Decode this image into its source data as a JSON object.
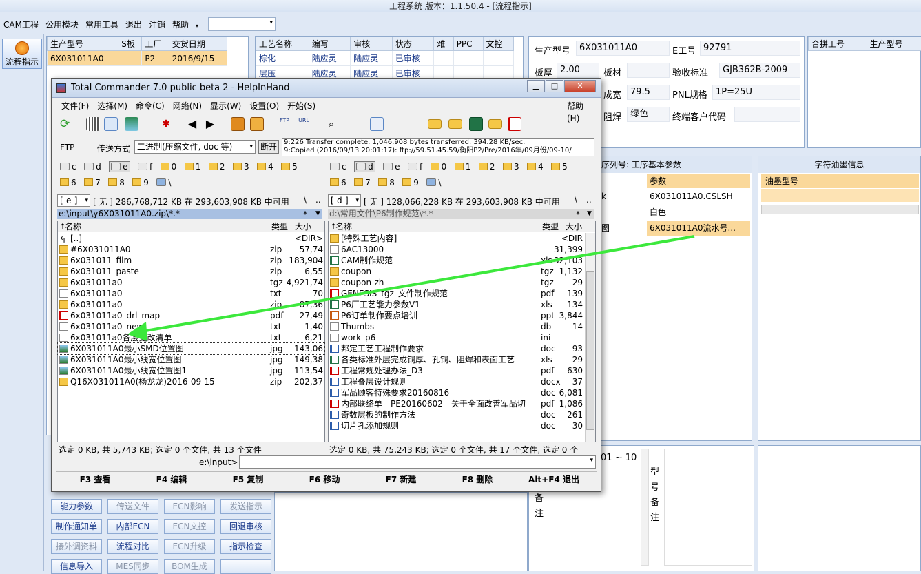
{
  "app": {
    "title": "工程系统   版本：1.1.50.4 - [流程指示]"
  },
  "menu": [
    "CAM工程",
    "公用模块",
    "常用工具",
    "退出",
    "注销",
    "帮助"
  ],
  "flow_button": "流程指示",
  "orders": {
    "headers": [
      "生产型号",
      "S板",
      "工厂",
      "交货日期"
    ],
    "rows": [
      [
        "6X031011A0",
        "",
        "P2",
        "2016/9/15"
      ]
    ]
  },
  "process": {
    "headers": [
      "工艺名称",
      "编写",
      "审核",
      "状态",
      "难",
      "PPC",
      "文控"
    ],
    "rows": [
      [
        "棕化",
        "陆应灵",
        "陆应灵",
        "已审核"
      ],
      [
        "层压",
        "陆应灵",
        "陆应灵",
        "已审核"
      ]
    ]
  },
  "info": {
    "model_label": "生产型号",
    "model": "6X031011A0",
    "e_label": "E工号",
    "e_value": "92791",
    "thick_label": "板厚",
    "thick": "2.00",
    "material_label": "板材",
    "material": "",
    "std_label": "验收标准",
    "std": "GJB362B-2009",
    "width_label": "成宽",
    "width": "79.5",
    "pnl_label": "PNL规格",
    "pnl": "1P=25U",
    "mask_label": "阻焊",
    "mask": "绿色",
    "customer_label": "终端客户代码",
    "customer": ""
  },
  "merge": {
    "headers": [
      "合拼工号",
      "生产型号"
    ]
  },
  "params": {
    "title": "序列号: 工序基本参数",
    "col": "参数",
    "rows": [
      [
        "k",
        "6X031011A0.CSLSH"
      ],
      [
        "",
        "白色"
      ],
      [
        "图",
        "6X031011A0流水号..."
      ]
    ]
  },
  "ink": {
    "title": "字符油墨信息",
    "col": "油墨型号"
  },
  "remark": {
    "range": "01 ~ 10",
    "model_v": "型号备注",
    "remark_v": "备注"
  },
  "buttons": [
    [
      "能力参数",
      "传送文件",
      "ECN影响",
      "发送指示"
    ],
    [
      "制作通知单",
      "内部ECN",
      "ECN文控",
      "回退审核"
    ],
    [
      "接外调资料",
      "流程对比",
      "ECN升级",
      "指示检查"
    ],
    [
      "信息导入",
      "MES同步",
      "BOM生成",
      ""
    ]
  ],
  "tc": {
    "title": "Total Commander 7.0 public beta 2 - HelpInHand",
    "menu": [
      "文件(F)",
      "选择(M)",
      "命令(C)",
      "网络(N)",
      "显示(W)",
      "设置(O)",
      "开始(S)"
    ],
    "help": "帮助(H)",
    "ftp_label": "FTP",
    "transfer_label": "传送方式",
    "transfer_mode": "二进制(压缩文件, doc 等)",
    "disconnect": "断开",
    "log1": "9:226 Transfer complete. 1,046,908 bytes transferred. 394.28 KB/sec.",
    "log2": "9:Copied (2016/09/13 20:01:17): ftp://59.51.45.59/衡阳P2/Pre/2016年/09月份/09-10/",
    "drives_a": [
      "c",
      "d",
      "e",
      "f",
      "0",
      "1",
      "2",
      "3",
      "4",
      "5"
    ],
    "drives_b": [
      "6",
      "7",
      "8",
      "9",
      "\\"
    ],
    "left": {
      "drive": "[-e-]",
      "free": "[ 无 ]  286,768,712 KB 在 293,603,908 KB 中可用",
      "path": "e:\\input\\y6X031011A0.zip\\*.*",
      "status": "选定 0 KB, 共 5,743 KB; 选定 0 个文件, 共 13 个文件",
      "files": [
        [
          "[..]",
          "",
          "<DIR>",
          "up"
        ],
        [
          "#6X031011A0",
          "zip",
          "57,74",
          "zip"
        ],
        [
          "6x031011_film",
          "zip",
          "183,904",
          "zip"
        ],
        [
          "6x031011_paste",
          "zip",
          "6,55",
          "zip"
        ],
        [
          "6x031011a0",
          "tgz",
          "4,921,74",
          "zip"
        ],
        [
          "6x031011a0",
          "txt",
          "70",
          "txt"
        ],
        [
          "6x031011a0",
          "zip",
          "87,36",
          "zip"
        ],
        [
          "6x031011a0_drl_map",
          "pdf",
          "27,49",
          "pdf"
        ],
        [
          "6x031011a0_new",
          "txt",
          "1,40",
          "txt"
        ],
        [
          "6x031011a0各层更改清单",
          "txt",
          "6,21",
          "txt"
        ],
        [
          "6X031011A0最小SMD位置图",
          "jpg",
          "143,06",
          "jpg"
        ],
        [
          "6X031011A0最小线宽位置图",
          "jpg",
          "149,38",
          "jpg"
        ],
        [
          "6X031011A0最小线宽位置图1",
          "jpg",
          "113,54",
          "jpg"
        ],
        [
          "Q16X031011A0(杨龙龙)2016-09-15",
          "zip",
          "202,37",
          "zip"
        ]
      ]
    },
    "right": {
      "drive": "[-d-]",
      "free": "[ 无 ]  128,066,228 KB 在 293,603,908 KB 中可用",
      "path": "d:\\常用文件\\P6制作规范\\*.*",
      "status": "选定 0 KB, 共 75,243 KB; 选定 0 个文件, 共 17 个文件, 选定 0 个",
      "files": [
        [
          "[特殊工艺内容]",
          "",
          "<DIR",
          "zip"
        ],
        [
          "6AC13000",
          "",
          "31,399",
          "txt"
        ],
        [
          "CAM制作规范",
          "xls",
          "32,103",
          "xls"
        ],
        [
          "coupon",
          "tgz",
          "1,132",
          "zip"
        ],
        [
          "coupon-zh",
          "tgz",
          "29",
          "zip"
        ],
        [
          "GENESIS_tgz_文件制作规范",
          "pdf",
          "139",
          "pdf"
        ],
        [
          "P6厂工艺能力参数V1",
          "xls",
          "134",
          "xls"
        ],
        [
          "P6订单制作要点培训",
          "ppt",
          "3,844",
          "ppt"
        ],
        [
          "Thumbs",
          "db",
          "14",
          "txt"
        ],
        [
          "work_p6",
          "ini",
          "",
          "txt"
        ],
        [
          "邦定工艺工程制作要求",
          "doc",
          "93",
          "doc"
        ],
        [
          "各类标准外层完成铜厚、孔铜、阻焊和表面工艺",
          "xls",
          "29",
          "xls"
        ],
        [
          "工程常规处理办法_D3",
          "pdf",
          "630",
          "pdf"
        ],
        [
          "工程叠层设计规则",
          "docx",
          "37",
          "doc"
        ],
        [
          "军品顾客特殊要求20160816",
          "doc",
          "6,081",
          "doc"
        ],
        [
          "内部联络单—PE20160602—关于全面改善军品切",
          "pdf",
          "1,086",
          "pdf"
        ],
        [
          "奇数层板的制作方法",
          "doc",
          "261",
          "doc"
        ],
        [
          "切片孔添加规则",
          "doc",
          "30",
          "doc"
        ]
      ]
    },
    "col_name": "名称",
    "col_type": "类型",
    "col_size": "大小",
    "cmd_path": "e:\\input>",
    "fkeys": [
      "F3 查看",
      "F4 编辑",
      "F5 复制",
      "F6 移动",
      "F7 新建",
      "F8 删除",
      "Alt+F4 退出"
    ]
  }
}
